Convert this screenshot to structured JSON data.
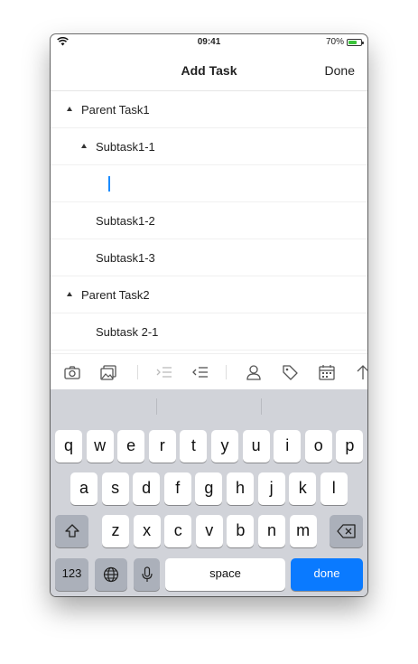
{
  "status_bar": {
    "time": "09:41",
    "battery": "70%",
    "battery_level": 0.7
  },
  "nav": {
    "title": "Add Task",
    "done_label": "Done"
  },
  "tasks": [
    {
      "label": "Parent Task1"
    },
    {
      "label": "Subtask1-1"
    },
    {
      "label": ""
    },
    {
      "label": "Subtask1-2"
    },
    {
      "label": "Subtask1-3"
    },
    {
      "label": "Parent Task2"
    },
    {
      "label": "Subtask 2-1"
    }
  ],
  "toolbar": {
    "icons": [
      "camera-icon",
      "image-icon",
      "indent-icon",
      "outdent-icon",
      "person-icon",
      "tag-icon",
      "calendar-icon",
      "arrow-up-icon"
    ]
  },
  "keyboard": {
    "row1": [
      "q",
      "w",
      "e",
      "r",
      "t",
      "y",
      "u",
      "i",
      "o",
      "p"
    ],
    "row2": [
      "a",
      "s",
      "d",
      "f",
      "g",
      "h",
      "j",
      "k",
      "l"
    ],
    "row3": [
      "z",
      "x",
      "c",
      "v",
      "b",
      "n",
      "m"
    ],
    "numbers_label": "123",
    "space_label": "space",
    "done_label": "done",
    "accent_color": "#0a7aff"
  }
}
